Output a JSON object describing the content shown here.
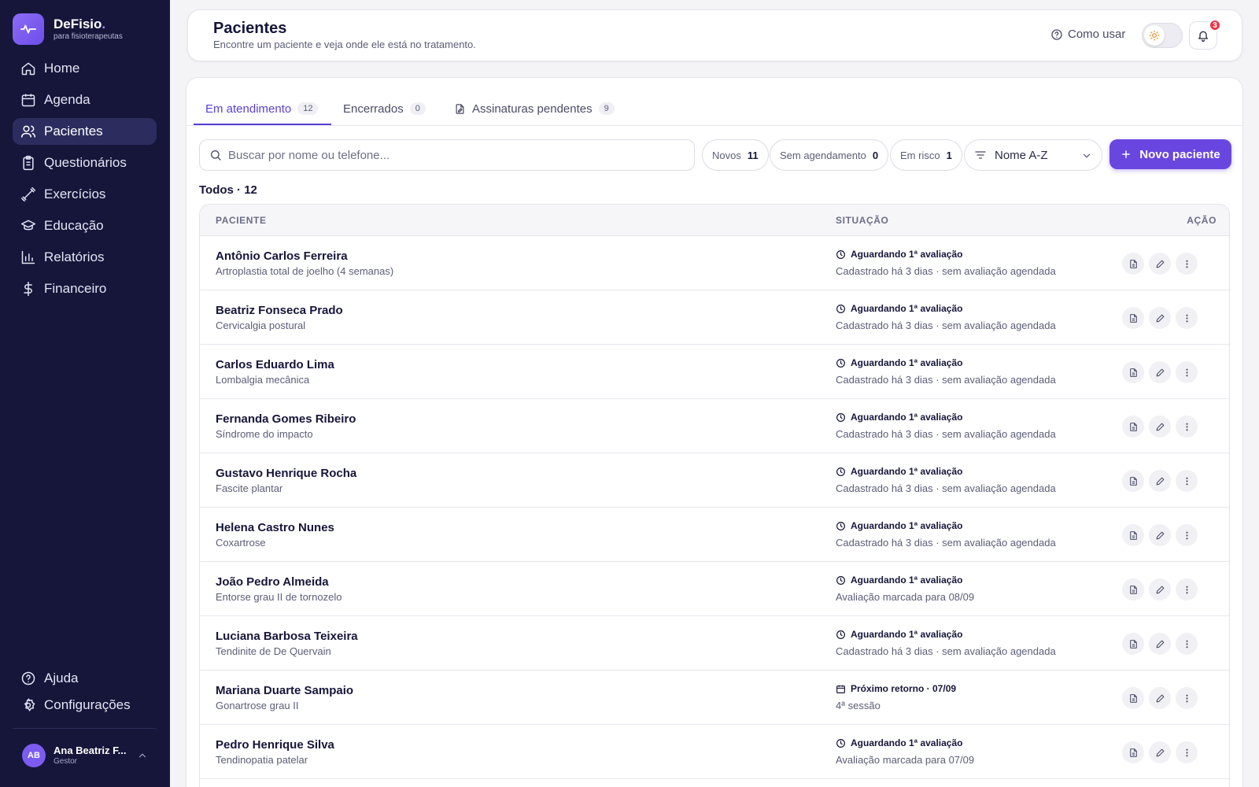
{
  "brand": {
    "name": "DeFisio",
    "dot": ".",
    "subtitle": "para fisioterapeutas"
  },
  "sidebar": {
    "items": [
      {
        "label": "Home",
        "icon": "home-icon"
      },
      {
        "label": "Agenda",
        "icon": "calendar-icon"
      },
      {
        "label": "Pacientes",
        "icon": "users-icon",
        "active": true
      },
      {
        "label": "Questionários",
        "icon": "clipboard-icon"
      },
      {
        "label": "Exercícios",
        "icon": "dumbbell-icon"
      },
      {
        "label": "Educação",
        "icon": "graduation-cap-icon"
      },
      {
        "label": "Relatórios",
        "icon": "bar-chart-icon"
      },
      {
        "label": "Financeiro",
        "icon": "dollar-icon"
      }
    ],
    "bottom": [
      {
        "label": "Ajuda",
        "icon": "help-circle-icon"
      },
      {
        "label": "Configurações",
        "icon": "gear-icon"
      }
    ],
    "user": {
      "initials": "AB",
      "name": "Ana Beatriz F...",
      "role": "Gestor"
    }
  },
  "header": {
    "title": "Pacientes",
    "subtitle": "Encontre um paciente e veja onde ele está no tratamento.",
    "help_label": "Como usar",
    "notifications": "3"
  },
  "tabs": [
    {
      "label": "Em atendimento",
      "count": "12",
      "active": true
    },
    {
      "label": "Encerrados",
      "count": "0"
    },
    {
      "label": "Assinaturas pendentes",
      "count": "9",
      "icon": "file-signature-icon"
    }
  ],
  "search": {
    "placeholder": "Buscar por nome ou telefone..."
  },
  "filters": [
    {
      "label": "Novos",
      "count": "11"
    },
    {
      "label": "Sem agendamento",
      "count": "0"
    },
    {
      "label": "Em risco",
      "count": "1"
    }
  ],
  "sort": {
    "value": "Nome A-Z"
  },
  "new_button": {
    "label": "Novo paciente"
  },
  "list": {
    "title": "Todos · 12"
  },
  "table": {
    "headers": {
      "patient": "PACIENTE",
      "status": "SITUAÇÃO",
      "action": "AÇÃO"
    },
    "rows": [
      {
        "name": "Antônio Carlos Ferreira",
        "diagnosis": "Artroplastia total de joelho (4 semanas)",
        "status": "Aguardando 1ª avaliação",
        "status_icon": "clock-icon",
        "detail": "Cadastrado há 3 dias · sem avaliação agendada"
      },
      {
        "name": "Beatriz Fonseca Prado",
        "diagnosis": "Cervicalgia postural",
        "status": "Aguardando 1ª avaliação",
        "status_icon": "clock-icon",
        "detail": "Cadastrado há 3 dias · sem avaliação agendada"
      },
      {
        "name": "Carlos Eduardo Lima",
        "diagnosis": "Lombalgia mecânica",
        "status": "Aguardando 1ª avaliação",
        "status_icon": "clock-icon",
        "detail": "Cadastrado há 3 dias · sem avaliação agendada"
      },
      {
        "name": "Fernanda Gomes Ribeiro",
        "diagnosis": "Síndrome do impacto",
        "status": "Aguardando 1ª avaliação",
        "status_icon": "clock-icon",
        "detail": "Cadastrado há 3 dias · sem avaliação agendada"
      },
      {
        "name": "Gustavo Henrique Rocha",
        "diagnosis": "Fascite plantar",
        "status": "Aguardando 1ª avaliação",
        "status_icon": "clock-icon",
        "detail": "Cadastrado há 3 dias · sem avaliação agendada"
      },
      {
        "name": "Helena Castro Nunes",
        "diagnosis": "Coxartrose",
        "status": "Aguardando 1ª avaliação",
        "status_icon": "clock-icon",
        "detail": "Cadastrado há 3 dias · sem avaliação agendada"
      },
      {
        "name": "João Pedro Almeida",
        "diagnosis": "Entorse grau II de tornozelo",
        "status": "Aguardando 1ª avaliação",
        "status_icon": "clock-icon",
        "detail": "Avaliação marcada para 08/09"
      },
      {
        "name": "Luciana Barbosa Teixeira",
        "diagnosis": "Tendinite de De Quervain",
        "status": "Aguardando 1ª avaliação",
        "status_icon": "clock-icon",
        "detail": "Cadastrado há 3 dias · sem avaliação agendada"
      },
      {
        "name": "Mariana Duarte Sampaio",
        "diagnosis": "Gonartrose grau II",
        "status": "Próximo retorno · 07/09",
        "status_icon": "calendar-icon",
        "detail": "4ª sessão"
      },
      {
        "name": "Pedro Henrique Silva",
        "diagnosis": "Tendinopatia patelar",
        "status": "Aguardando 1ª avaliação",
        "status_icon": "clock-icon",
        "detail": "Avaliação marcada para 07/09"
      }
    ]
  },
  "colors": {
    "sidebar_bg": "#15163a",
    "accent": "#6a46e0",
    "active_nav": "#2c2d5e",
    "badge": "#e5384a"
  }
}
